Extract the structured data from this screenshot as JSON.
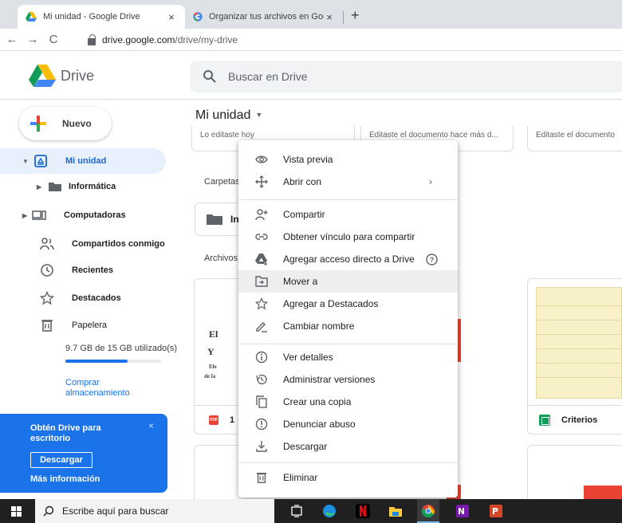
{
  "browser": {
    "tabs": [
      {
        "title": "Mi unidad - Google Drive",
        "close": "×"
      },
      {
        "title": "Organizar tus archivos en Google",
        "close": "×"
      }
    ],
    "new_tab": "+",
    "nav": {
      "back": "←",
      "forward": "→",
      "reload": "C"
    },
    "url_host": "drive.google.com",
    "url_path": "/drive/my-drive"
  },
  "header": {
    "app_name": "Drive",
    "search_placeholder": "Buscar en Drive"
  },
  "sidebar": {
    "new_label": "Nuevo",
    "items": [
      {
        "label": "Mi unidad"
      },
      {
        "label": "Informática"
      },
      {
        "label": "Computadoras"
      },
      {
        "label": "Compartidos conmigo"
      },
      {
        "label": "Recientes"
      },
      {
        "label": "Destacados"
      },
      {
        "label": "Papelera"
      }
    ],
    "storage_text": "9.7 GB de 15 GB utilizado(s)",
    "storage_fraction": 0.65,
    "buy_label": "Comprar almacenamiento"
  },
  "promo": {
    "title": "Obtén Drive para escritorio",
    "close": "×",
    "download_label": "Descargar",
    "more_label": "Más información"
  },
  "main": {
    "title": "Mi unidad",
    "dropdown": "▼",
    "suggested": [
      {
        "subtitle": "Lo editaste hoy"
      },
      {
        "subtitle": "Editaste el documento hace más d..."
      },
      {
        "subtitle": "Editaste el documento"
      }
    ],
    "folders_label": "Carpetas",
    "folder_name": "In",
    "files_label": "Archivos",
    "files": [
      {
        "name": "1",
        "badge": "PDF",
        "preview_line1": "El",
        "preview_line2": "Y",
        "preview_line3": "Ele",
        "preview_line4": "de la"
      },
      {
        "name": "Criterios"
      }
    ]
  },
  "context_menu": {
    "items": [
      {
        "label": "Vista previa",
        "icon": "eye-icon"
      },
      {
        "label": "Abrir con",
        "icon": "move-arrows-icon",
        "submenu": "›"
      },
      {
        "label": "Compartir",
        "icon": "person-add-icon"
      },
      {
        "label": "Obtener vínculo para compartir",
        "icon": "link-icon"
      },
      {
        "label": "Agregar acceso directo a Drive",
        "icon": "drive-shortcut-icon",
        "help": "?"
      },
      {
        "label": "Mover a",
        "icon": "folder-move-icon"
      },
      {
        "label": "Agregar a Destacados",
        "icon": "star-icon"
      },
      {
        "label": "Cambiar nombre",
        "icon": "pencil-icon"
      },
      {
        "label": "Ver detalles",
        "icon": "info-icon"
      },
      {
        "label": "Administrar versiones",
        "icon": "history-icon"
      },
      {
        "label": "Crear una copia",
        "icon": "copy-icon"
      },
      {
        "label": "Denunciar abuso",
        "icon": "report-icon"
      },
      {
        "label": "Descargar",
        "icon": "download-icon"
      },
      {
        "label": "Eliminar",
        "icon": "trash-icon"
      }
    ]
  },
  "taskbar": {
    "search_placeholder": "Escribe aquí para buscar"
  },
  "colors": {
    "accent": "#1a73e8",
    "selected_bg": "#e8f0fe",
    "pdf_red": "#ea4335",
    "sheets_green": "#0f9d58"
  }
}
